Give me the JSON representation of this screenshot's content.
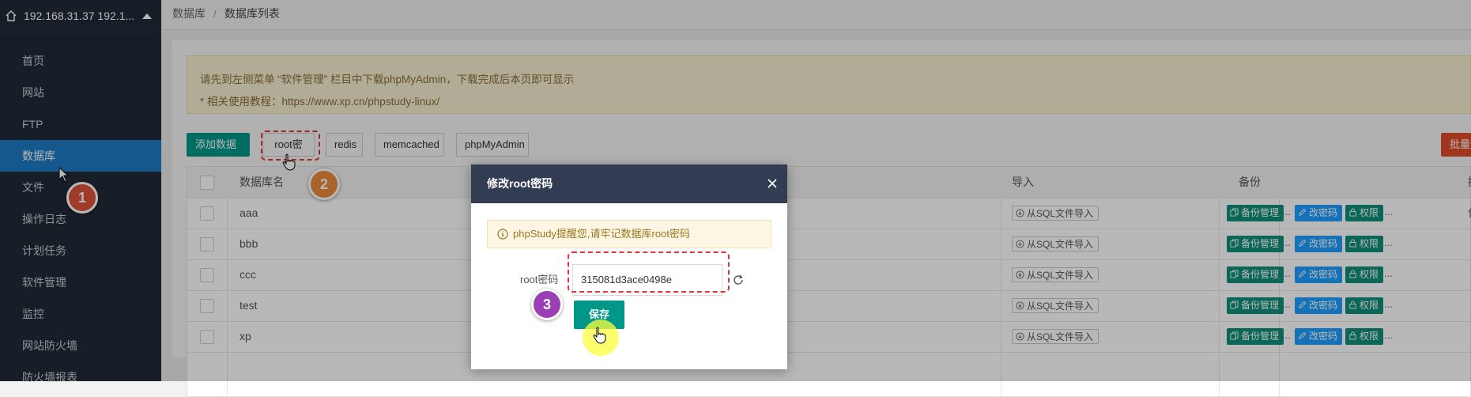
{
  "sidebar": {
    "host": "192.168.31.37 192.1...",
    "items": [
      {
        "label": "首页"
      },
      {
        "label": "网站"
      },
      {
        "label": "FTP"
      },
      {
        "label": "数据库"
      },
      {
        "label": "文件"
      },
      {
        "label": "操作日志"
      },
      {
        "label": "计划任务"
      },
      {
        "label": "软件管理"
      },
      {
        "label": "监控"
      },
      {
        "label": "网站防火墙"
      },
      {
        "label": "防火墙报表"
      }
    ]
  },
  "breadcrumb": {
    "root": "数据库",
    "sep": "/",
    "current": "数据库列表"
  },
  "notice": {
    "line1": "请先到左侧菜单 “软件管理” 栏目中下载phpMyAdmin，下载完成后本页即可显示",
    "line2": "* 相关使用教程：https://www.xp.cn/phpstudy-linux/"
  },
  "toolbar": {
    "add_db": "添加数据库",
    "root_pwd": "root密码",
    "redis": "redis",
    "memcached": "memcached",
    "phpmyadmin": "phpMyAdmin",
    "batch_delete": "批量删除"
  },
  "table": {
    "headers": {
      "name": "数据库名",
      "import": "导入",
      "backup": "备份",
      "ops": "操作"
    },
    "rows": [
      {
        "name": "aaa"
      },
      {
        "name": "bbb"
      },
      {
        "name": "ccc"
      },
      {
        "name": "test"
      },
      {
        "name": "xp"
      }
    ],
    "import_label": "从SQL文件导入",
    "backup_label": "备份管理",
    "pwd_label": "改密码",
    "perm_label": "权限",
    "more": "..."
  },
  "modal": {
    "title": "修改root密码",
    "tip": "phpStudy提醒您,请牢记数据库root密码",
    "field_label": "root密码",
    "field_value": "315081d3ace0498e",
    "save": "保存"
  },
  "annotations": {
    "step1": "1",
    "step2": "2",
    "step3": "3"
  },
  "colors": {
    "sidebar_bg": "#202a37",
    "active": "#1e7bc4",
    "primary_green": "#009688",
    "danger": "#e04b2c",
    "modal_header": "#323d53",
    "step1": "#e0533a",
    "step2": "#ec8a3c",
    "step3": "#9b3fb5"
  },
  "icons": {
    "home": "home-icon",
    "caret": "caret-up-icon",
    "close": "close-icon",
    "info": "info-icon",
    "refresh": "refresh-icon",
    "import": "download-icon",
    "backup": "copy-icon",
    "edit": "pencil-icon",
    "lock": "lock-icon",
    "cursor": "pointer-cursor-icon",
    "hand": "hand-cursor-icon"
  }
}
